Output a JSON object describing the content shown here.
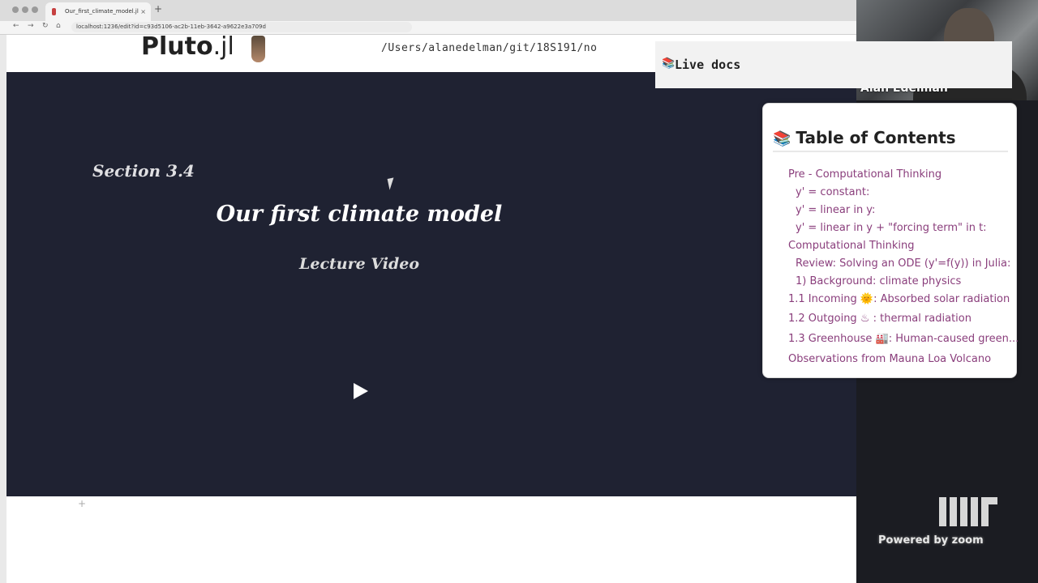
{
  "browser": {
    "tab_title": "Our_first_climate_model.jl",
    "tab_close": "×",
    "new_tab": "+",
    "url": "localhost:1236/edit?id=c93d5106-ac2b-11eb-3642-a9622e3a709d"
  },
  "header": {
    "logo_main": "Pluto",
    "logo_suffix": ".jl",
    "path": "/Users/alanedelman/git/18S191/no"
  },
  "notebook": {
    "section": "Section 3.4",
    "title": "Our first climate model",
    "subtitle": "Lecture Video"
  },
  "toc": {
    "title": "Table of Contents",
    "icon": "books-icon",
    "items": [
      {
        "label": "Pre - Computational Thinking",
        "level": 1
      },
      {
        "label": "y' = constant:",
        "level": 2
      },
      {
        "label": "y' = linear in y:",
        "level": 2
      },
      {
        "label": "y' = linear in y + \"forcing term\" in t:",
        "level": 2
      },
      {
        "label": "Computational Thinking",
        "level": 1
      },
      {
        "label": "Review: Solving an ODE (y'=f(y)) in Julia:",
        "level": 2
      },
      {
        "label": "1) Background: climate physics",
        "level": 2
      },
      {
        "label": "1.1 Incoming 🌞: Absorbed solar radiation",
        "level": 1
      },
      {
        "label": "1.2 Outgoing ♨ : thermal radiation",
        "level": 1
      },
      {
        "label": "1.3 Greenhouse 🏭: Human-caused green...",
        "level": 1
      },
      {
        "label": "Observations from Mauna Loa Volcano",
        "level": 1
      }
    ]
  },
  "livedocs": {
    "label": "Live docs"
  },
  "video": {
    "participant_name": "Alan Edelman",
    "powered_by": "Powered by zoom"
  }
}
